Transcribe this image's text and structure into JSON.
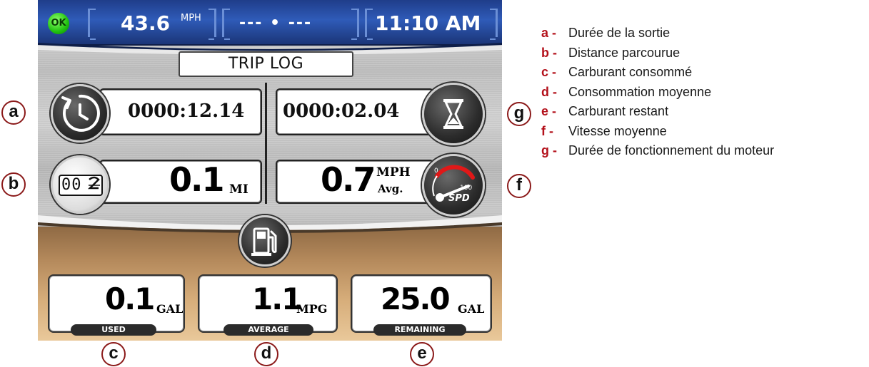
{
  "status_bar": {
    "ok_label": "OK",
    "speed_value": "43.6",
    "speed_unit": "MPH",
    "heading_text": "--- • ---",
    "clock": "11:10 AM"
  },
  "trip_log": {
    "title": "TRIP LOG",
    "trip_duration": "0000:12.14",
    "engine_hours": "0000:02.04",
    "distance_value": "0.1",
    "distance_unit": "MI",
    "odometer_digits": "00",
    "avg_speed_value": "0.7",
    "avg_speed_unit": "MPH",
    "avg_speed_suffix": "Avg.",
    "speedo_min": "0",
    "speedo_max": "100",
    "speedo_label": "SPD",
    "fuel_used_value": "0.1",
    "fuel_used_unit": "GAL",
    "fuel_used_label": "USED",
    "economy_value": "1.1",
    "economy_unit": "MPG",
    "economy_label": "AVERAGE",
    "remaining_value": "25.0",
    "remaining_unit": "GAL",
    "remaining_label": "REMAINING"
  },
  "callouts": {
    "a": "a",
    "b": "b",
    "c": "c",
    "d": "d",
    "e": "e",
    "f": "f",
    "g": "g"
  },
  "legend": [
    {
      "key": "a -",
      "text": "Durée de la sortie"
    },
    {
      "key": "b -",
      "text": "Distance parcourue"
    },
    {
      "key": "c -",
      "text": "Carburant consommé"
    },
    {
      "key": "d -",
      "text": "Consommation moyenne"
    },
    {
      "key": "e -",
      "text": "Carburant restant"
    },
    {
      "key": "f -",
      "text": "Vitesse moyenne"
    },
    {
      "key": "g -",
      "text": "Durée de fonctionnement du moteur"
    }
  ],
  "colors": {
    "accent_red": "#b3101a",
    "top_bar_blue": "#2f5bb8",
    "ok_green": "#20c10f"
  }
}
